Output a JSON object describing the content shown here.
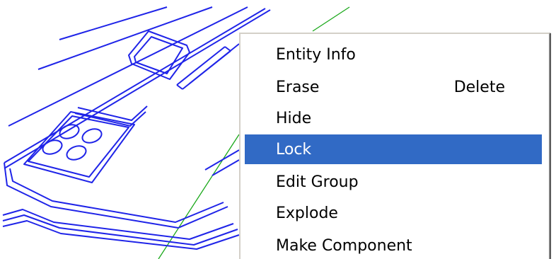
{
  "colors": {
    "model_lines": "#1f24e8",
    "axis_green": "#1aa81a",
    "canvas_background": "#ffffff",
    "menu_background": "#ffffff",
    "menu_highlight": "#316ac5",
    "menu_text": "#000000",
    "menu_text_highlighted": "#ffffff"
  },
  "context_menu": {
    "items": [
      {
        "label": "Entity Info",
        "shortcut": "",
        "highlighted": false
      },
      {
        "label": "Erase",
        "shortcut": "Delete",
        "highlighted": false
      },
      {
        "label": "Hide",
        "shortcut": "",
        "highlighted": false
      },
      {
        "label": "Lock",
        "shortcut": "",
        "highlighted": true
      },
      {
        "label": "Edit Group",
        "shortcut": "",
        "highlighted": false
      },
      {
        "label": "Explode",
        "shortcut": "",
        "highlighted": false
      },
      {
        "label": "Make Component",
        "shortcut": "",
        "highlighted": false
      }
    ]
  }
}
